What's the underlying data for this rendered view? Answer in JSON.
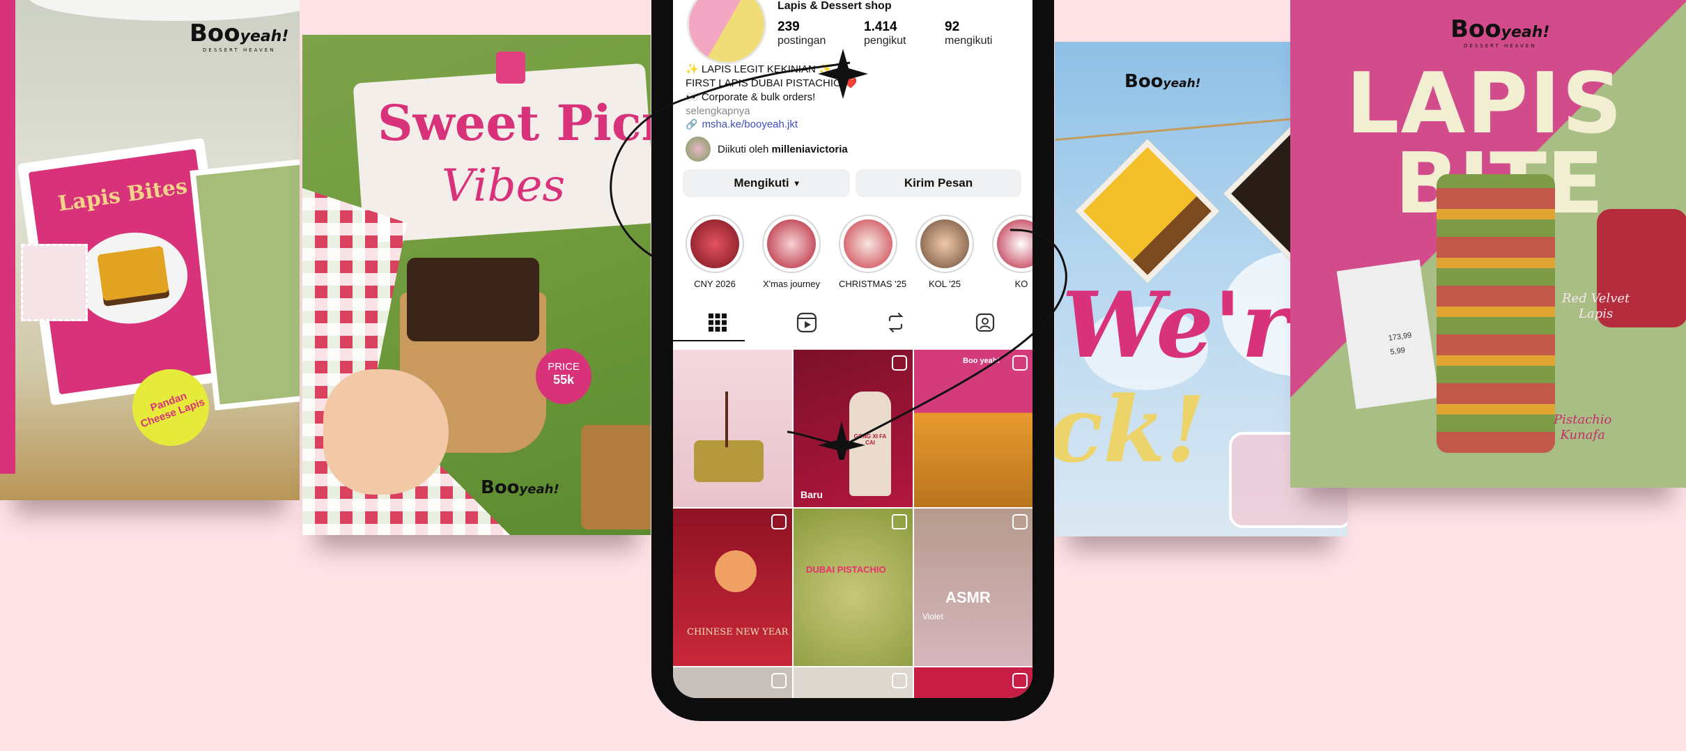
{
  "posters": {
    "p1": {
      "logo_main": "Boo",
      "logo_sub": "yeah!",
      "tagline": "DESSERT HEAVEN",
      "card_title": "Lapis Bites",
      "sticker": "Pandan Cheese Lapis"
    },
    "p2": {
      "title_line1": "Sweet Picnic",
      "title_line2": "Vibes",
      "price_label": "PRICE",
      "price_value": "55k",
      "logo_main": "Boo",
      "logo_sub": "yeah!"
    },
    "p3": {
      "logo_main": "Boo",
      "logo_sub": "yeah!",
      "headline_line1": "We're",
      "headline_line2": "ck!"
    },
    "p4": {
      "logo_main": "Boo",
      "logo_sub": "yeah!",
      "tagline": "DESSERT HEAVEN",
      "title_line1": "LAPIS",
      "title_line2": "BITE",
      "note1_line1": "Red Velvet",
      "note1_line2": "Lapis",
      "note2_line1": "Pistachio",
      "note2_line2": "Kunafa",
      "price1": "173,99",
      "price2": "5,99"
    }
  },
  "profile": {
    "category": "Lapis & Dessert shop",
    "stats": [
      {
        "value": "239",
        "label": "postingan"
      },
      {
        "value": "1.414",
        "label": "pengikut"
      },
      {
        "value": "92",
        "label": "mengikuti"
      }
    ],
    "bio": [
      "✨ LAPIS LEGIT KEKINIAN ✨",
      "FIRST LAPIS DUBAI PISTACHIO ❤️",
      "👀 Corporate & bulk orders!"
    ],
    "more": "selengkapnya",
    "link": "msha.ke/booyeah.jkt",
    "followed_prefix": "Diikuti oleh ",
    "followed_user": "milleniavictoria"
  },
  "buttons": {
    "following": "Mengikuti",
    "message": "Kirim Pesan"
  },
  "highlights": [
    "CNY 2026",
    "X'mas journey",
    "CHRISTMAS '25",
    "KOL '25",
    "KO"
  ],
  "tabs": [
    "grid-icon",
    "reels-icon",
    "reposts-icon",
    "tagged-icon"
  ],
  "grid": {
    "new_label": "Baru",
    "bottle_text": "GONG XI FA CAI",
    "cny_text": "CHINESE NEW YEAR",
    "pistachio_text": "DUBAI PISTACHIO",
    "asmr_text": "ASMR",
    "asmr_sub": "Violet",
    "mini_logo": "Boo yeah!"
  },
  "colors": {
    "brand_pink": "#d8327a",
    "accent_green": "#a6bd7a",
    "ig_link": "#3d4fbf",
    "phone_frame": "#0d0d0d"
  }
}
